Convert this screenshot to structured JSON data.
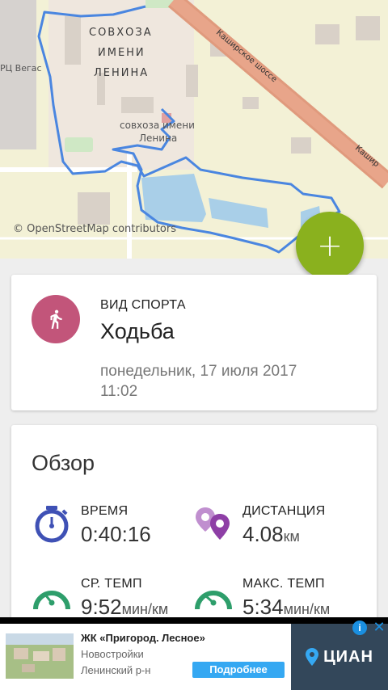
{
  "map": {
    "labels": {
      "district_line1": "СОВХОЗА",
      "district_line2": "ИМЕНИ",
      "district_line3": "ЛЕНИНА",
      "place_line1": "совхоза имени",
      "place_line2": "Ленина",
      "road1": "Каширское шоссе",
      "road2": "Кашир",
      "poi": "РЦ Вегас"
    },
    "attribution": "© OpenStreetMap contributors"
  },
  "fab": {
    "icon": "plus-icon",
    "color": "#8ab11e"
  },
  "sport": {
    "caption": "ВИД СПОРТА",
    "name": "Ходьба",
    "date_line1": "понедельник, 17 июля 2017",
    "date_line2": "11:02",
    "icon": "walking-person-icon",
    "accent": "#c2557a"
  },
  "overview": {
    "title": "Обзор",
    "stats": [
      {
        "label": "ВРЕМЯ",
        "value": "0:40:16",
        "unit": "",
        "icon": "stopwatch-icon",
        "color": "#3f51b5"
      },
      {
        "label": "ДИСТАНЦИЯ",
        "value": "4.08",
        "unit": "км",
        "icon": "location-pins-icon",
        "color": "#9c4bb0"
      },
      {
        "label": "СР. ТЕМП",
        "value": "9:52",
        "unit": "мин/км",
        "icon": "speedometer-icon",
        "color": "#2e9e6b"
      },
      {
        "label": "МАКС. ТЕМП",
        "value": "5:34",
        "unit": "мин/км",
        "icon": "speedometer-icon",
        "color": "#2e9e6b"
      }
    ]
  },
  "ad": {
    "title": "ЖК «Пригород. Лесное»",
    "line1": "Новостройки",
    "line2": "Ленинский р-н",
    "button": "Подробнее",
    "brand": "ЦИАН",
    "info": "i",
    "close": "✕"
  }
}
